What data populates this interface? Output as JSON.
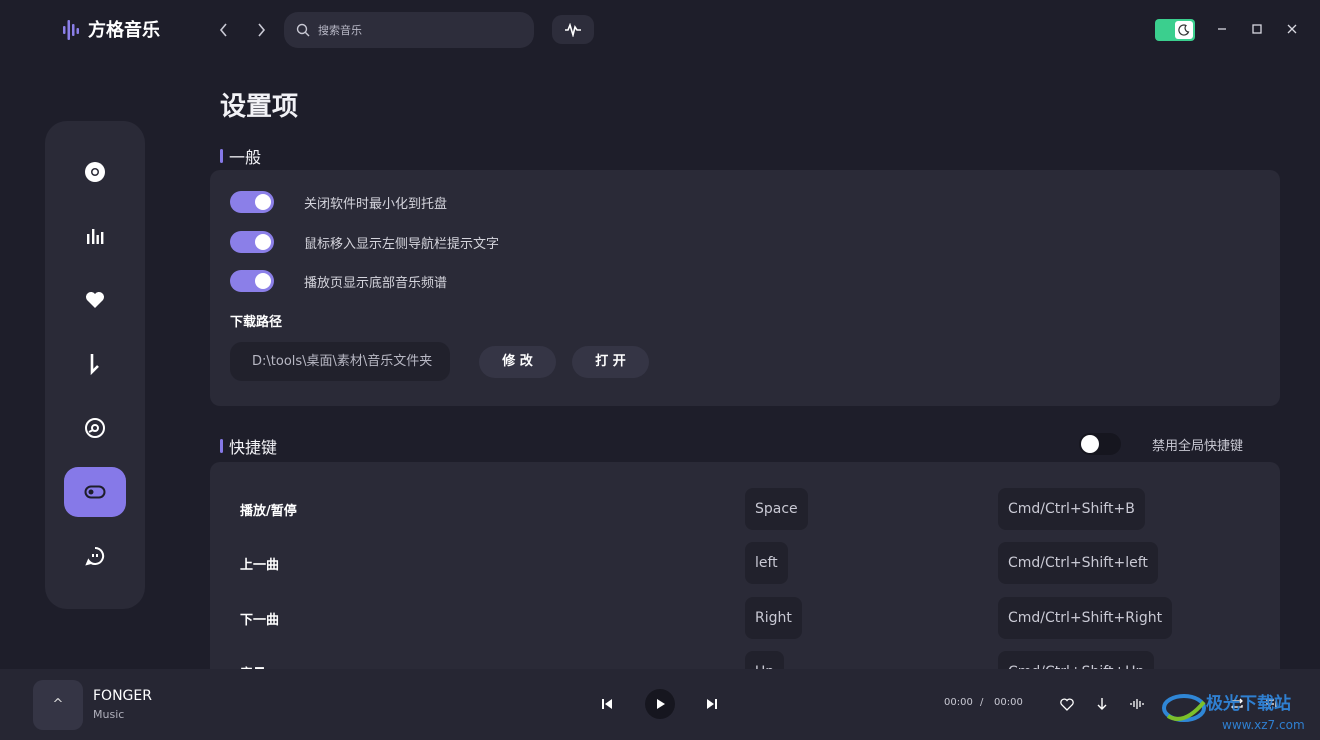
{
  "app": {
    "name": "方格音乐"
  },
  "search": {
    "placeholder": "搜索音乐"
  },
  "colors": {
    "accent": "#8679e8",
    "theme_toggle": "#3bcf8e",
    "bg": "#1e1e2a",
    "card": "#2a2a37"
  },
  "sidebar": {
    "items": [
      {
        "icon": "disc-icon"
      },
      {
        "icon": "chart-bars-icon"
      },
      {
        "icon": "heart-icon"
      },
      {
        "icon": "download-arrow-icon"
      },
      {
        "icon": "vinyl-icon"
      },
      {
        "icon": "settings-toggle-icon",
        "active": true
      },
      {
        "icon": "chat-bubble-icon"
      }
    ]
  },
  "settings": {
    "title": "设置项",
    "general": {
      "title": "一般",
      "toggles": [
        {
          "label": "关闭软件时最小化到托盘",
          "on": true
        },
        {
          "label": "鼠标移入显示左侧导航栏提示文字",
          "on": true
        },
        {
          "label": "播放页显示底部音乐频谱",
          "on": true
        }
      ],
      "download_label": "下载路径",
      "download_path": "D:\\tools\\桌面\\素材\\音乐文件夹",
      "modify_label": "修 改",
      "open_label": "打 开"
    },
    "shortcuts": {
      "title": "快捷键",
      "global_label": "禁用全局快捷键",
      "global_on": false,
      "rows": [
        {
          "name": "播放/暂停",
          "local": "Space",
          "global": "Cmd/Ctrl+Shift+B"
        },
        {
          "name": "上一曲",
          "local": "left",
          "global": "Cmd/Ctrl+Shift+left"
        },
        {
          "name": "下一曲",
          "local": "Right",
          "global": "Cmd/Ctrl+Shift+Right"
        },
        {
          "name": "音量",
          "local": "Up",
          "global": "Cmd/Ctrl+Shift+Up"
        }
      ]
    }
  },
  "player": {
    "song": "FONGER",
    "artist": "Music",
    "cover_symbol": "^",
    "current_time": "00:00",
    "separator": "/",
    "total_time": "00:00"
  },
  "watermark": {
    "text": "极光下载站",
    "url": "www.xz7.com"
  }
}
